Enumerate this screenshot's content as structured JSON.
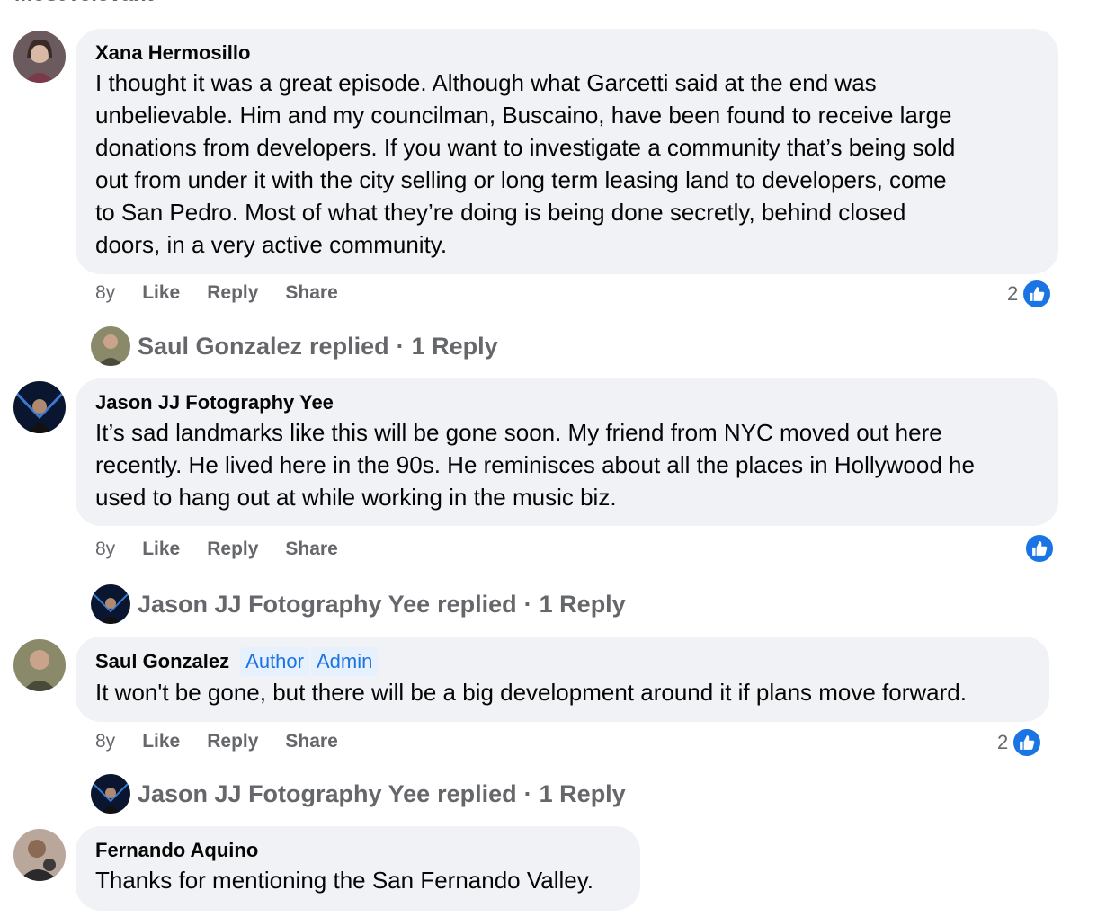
{
  "header": {
    "label": "Most relevant"
  },
  "comments": [
    {
      "author": "Xana Hermosillo",
      "lines": [
        "I thought it was a great episode. Although what Garcetti said at the end was",
        "unbelievable. Him and my councilman, Buscaino, have been found to receive large",
        "donations from developers. If you want to investigate a community that’s being sold",
        "out from under it with the city selling or long term leasing land to developers, come",
        "to San Pedro. Most of what they’re doing is being done secretly, behind closed",
        "doors, in a very active community."
      ],
      "time": "8y",
      "like": "Like",
      "reply": "Reply",
      "share": "Share",
      "reaction_count": "2",
      "replies": {
        "name": "Saul Gonzalez",
        "text": "replied",
        "dot": "·",
        "count": "1 Reply"
      }
    },
    {
      "author": "Jason JJ Fotography Yee",
      "lines": [
        "It’s sad landmarks like this will be gone soon. My friend from NYC moved out here",
        "recently. He lived here in the 90s. He reminisces about all the places in Hollywood he",
        "used to hang out at while working in the music biz."
      ],
      "time": "8y",
      "like": "Like",
      "reply": "Reply",
      "share": "Share",
      "reaction_count": "",
      "replies": {
        "name": "Jason JJ Fotography Yee",
        "text": "replied",
        "dot": "·",
        "count": "1 Reply"
      }
    },
    {
      "author": "Saul Gonzalez",
      "badges": [
        "Author",
        "Admin"
      ],
      "lines": [
        "It won't be gone, but there will be a big development around it if plans move forward."
      ],
      "time": "8y",
      "like": "Like",
      "reply": "Reply",
      "share": "Share",
      "reaction_count": "2",
      "replies": {
        "name": "Jason JJ Fotography Yee",
        "text": "replied",
        "dot": "·",
        "count": "1 Reply"
      }
    },
    {
      "author": "Fernando Aquino",
      "lines": [
        "Thanks for mentioning the San Fernando Valley."
      ]
    }
  ],
  "colors": {
    "accent": "#1b74e4",
    "bubble": "#f0f2f5",
    "muted": "#65676b"
  }
}
